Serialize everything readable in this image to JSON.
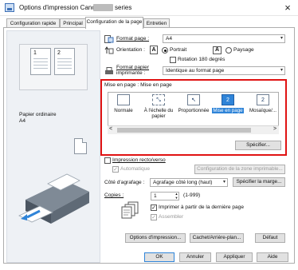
{
  "window": {
    "title": "Options d'impression Canon",
    "title_suffix": "series",
    "close_glyph": "×"
  },
  "tabs": [
    {
      "label": "Configuration rapide"
    },
    {
      "label": "Principal"
    },
    {
      "label": "Configuration de la page"
    },
    {
      "label": "Entretien"
    }
  ],
  "preview": {
    "page_numbers": [
      "1",
      "2"
    ],
    "media_type": "Papier ordinaire",
    "paper_size": "A4"
  },
  "page_size": {
    "label": "Format page :",
    "value": "A4"
  },
  "orientation": {
    "label": "Orientation :",
    "portrait_label": "Portrait",
    "landscape_label": "Paysage",
    "portrait_glyph": "A",
    "landscape_glyph": "A",
    "rotate_label": "Rotation 180 degrés",
    "selected": "Portrait",
    "rotate_checked": false
  },
  "printer_paper_size": {
    "label_line1": "Format papier",
    "label_line2": "imprimante :",
    "value": "Identique au format page"
  },
  "layout": {
    "header": "Mise en page : Mise en page",
    "items": [
      {
        "label": "Normale",
        "glyph": ""
      },
      {
        "label": "À l'échelle du papier",
        "glyph": "⤡"
      },
      {
        "label": "Proportionnée",
        "glyph": "↖"
      },
      {
        "label": "Mise en page",
        "glyph": "2"
      },
      {
        "label": "Mosaïque/...",
        "glyph": "2"
      }
    ],
    "selected": "Mise en page",
    "scroll_left": "<",
    "scroll_right": ">",
    "specify_button": "Spécifier..."
  },
  "duplex": {
    "label": "Impression recto/verso",
    "auto_label": "Automatique",
    "checked": false,
    "auto_checked": true,
    "print_area_button": "Configuration de la zone imprimable..."
  },
  "stapling": {
    "label": "Côté d'agrafage :",
    "value": "Agrafage côté long (haut)",
    "margin_button": "Spécifier la marge..."
  },
  "copies": {
    "label": "Copies :",
    "value": "1",
    "range": "(1-999)",
    "last_page_first_label": "Imprimer à partir de la dernière page",
    "collate_label": "Assembler",
    "last_page_first_checked": true,
    "collate_checked": true
  },
  "buttons": {
    "print_options": "Options d'impression...",
    "stamp_background": "Cachet/Arrière-plan...",
    "defaults": "Défaut",
    "ok": "OK",
    "cancel": "Annuler",
    "apply": "Appliquer",
    "help": "Aide"
  },
  "colors": {
    "highlight_border": "#e01313",
    "selection": "#2f84d8"
  },
  "icons": {
    "app": "printer-app-icon",
    "page_size": "page-size-icon",
    "orientation": "orientation-icon",
    "printer_paper": "printer-paper-icon",
    "copies": "copies-stack-icon"
  }
}
